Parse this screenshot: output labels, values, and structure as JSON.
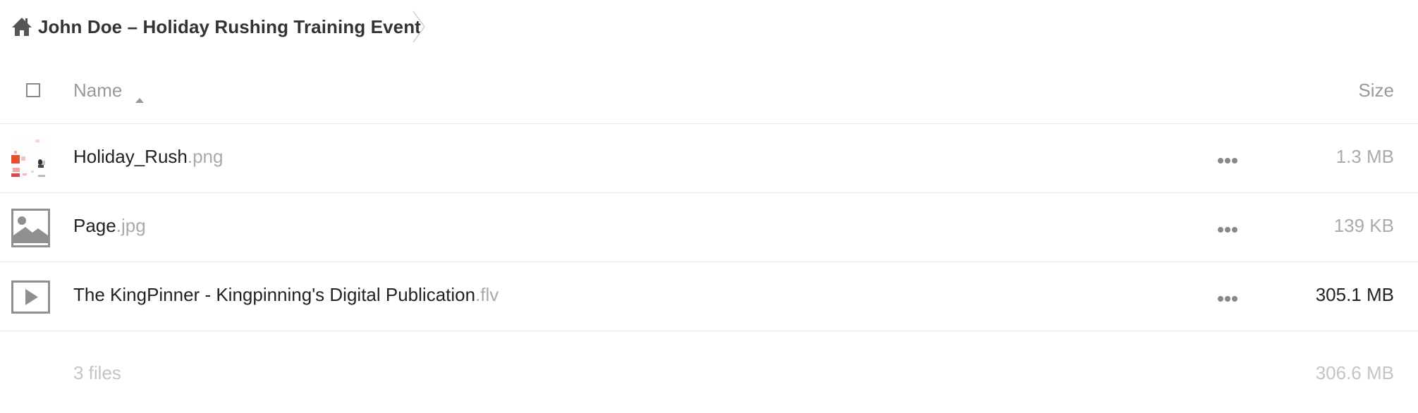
{
  "breadcrumb": {
    "home_icon": "home-icon",
    "folder_title": "John Doe – Holiday Rushing Training Event"
  },
  "table": {
    "select_all_checked": false,
    "columns": {
      "name": "Name",
      "name_sort": "ascending",
      "size": "Size"
    },
    "files": [
      {
        "base": "Holiday_Rush",
        "ext": ".png",
        "size": "1.3 MB",
        "size_color": "#aaaaaa",
        "thumbnail": "image-preview-thumbnail"
      },
      {
        "base": "Page",
        "ext": ".jpg",
        "size": "139 KB",
        "size_color": "#aaaaaa",
        "thumbnail": "image-file-icon"
      },
      {
        "base": "The KingPinner - Kingpinning's Digital Publication",
        "ext": ".flv",
        "size": "305.1 MB",
        "size_color": "#222222",
        "thumbnail": "video-file-icon"
      }
    ],
    "summary": {
      "count": "3 files",
      "total_size": "306.6 MB"
    }
  },
  "colors": {
    "icon_gray": "#8f8f8f",
    "muted_text": "#999999",
    "divider": "#ececec"
  }
}
